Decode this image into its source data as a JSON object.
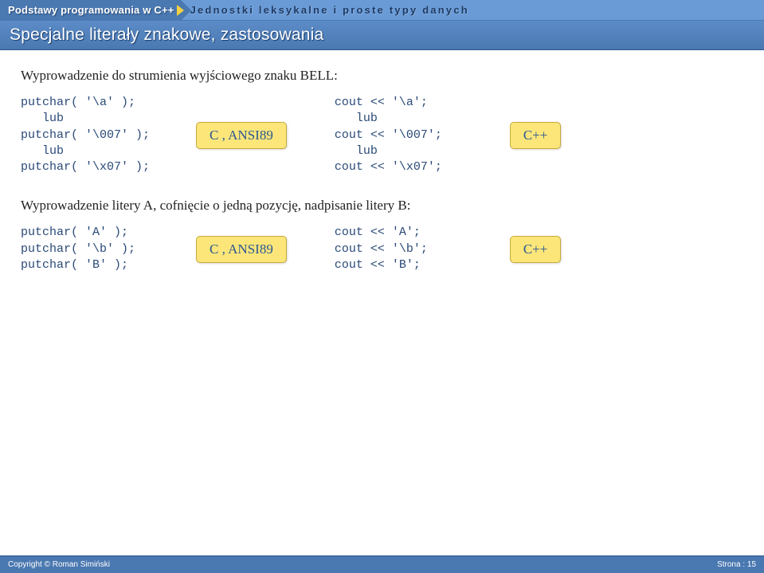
{
  "header": {
    "course": "Podstawy programowania w C++",
    "section": "Jednostki leksykalne i proste typy danych",
    "title": "Specjalne literały znakowe, zastosowania"
  },
  "body": {
    "lead1": "Wyprowadzenie do strumienia wyjściowego znaku BELL:",
    "block1_left": "putchar( '\\a' );\n   lub\nputchar( '\\007' );\n   lub\nputchar( '\\x07' );",
    "badge_c": "C , ANSI89",
    "block1_right": "cout << '\\a';\n   lub\ncout << '\\007';\n   lub\ncout << '\\x07';",
    "badge_cpp": "C++",
    "lead2": "Wyprowadzenie litery A, cofnięcie o jedną pozycję, nadpisanie litery B:",
    "block2_left": "putchar( 'A' );\nputchar( '\\b' );\nputchar( 'B' );",
    "block2_right": "cout << 'A';\ncout << '\\b';\ncout << 'B';"
  },
  "footer": {
    "copyright": "Copyright © Roman Simiński",
    "page_label": "Strona : 15"
  }
}
